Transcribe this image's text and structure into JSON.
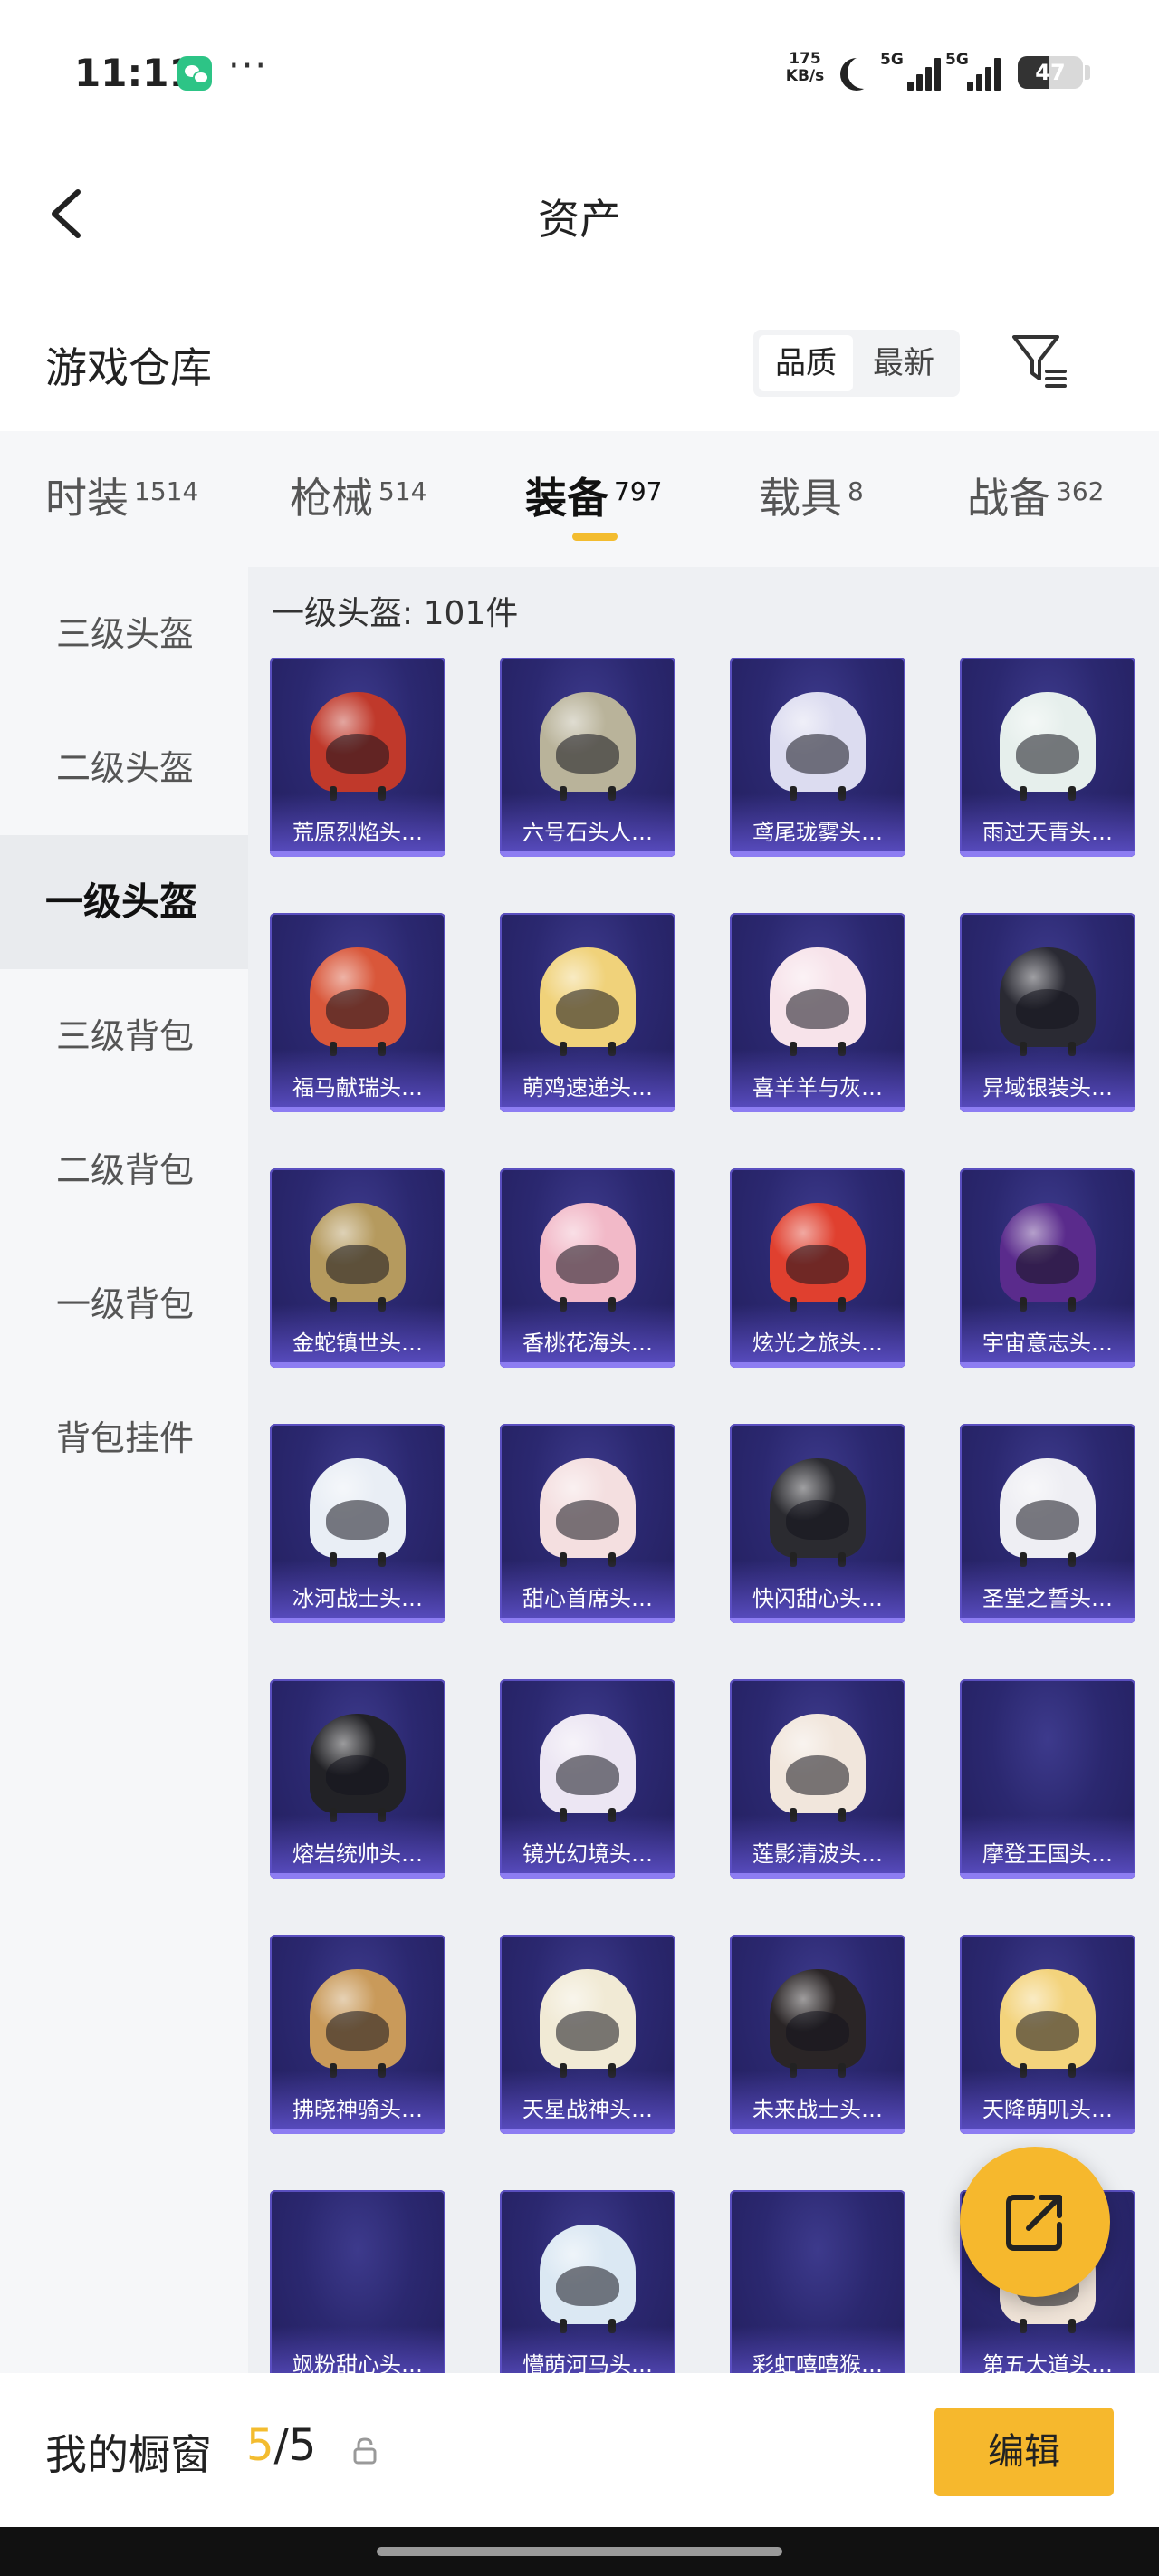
{
  "status_bar": {
    "time": "11:11",
    "net_speed_value": "175",
    "net_speed_unit": "KB/s",
    "signal1_label": "5G",
    "signal2_label": "5G",
    "battery_level": "47"
  },
  "header": {
    "title": "资产"
  },
  "section": {
    "title": "游戏仓库",
    "sort_options": [
      "品质",
      "最新"
    ],
    "active_sort": "品质"
  },
  "categories": [
    {
      "label": "时装",
      "count": "1514"
    },
    {
      "label": "枪械",
      "count": "514"
    },
    {
      "label": "装备",
      "count": "797"
    },
    {
      "label": "载具",
      "count": "8"
    },
    {
      "label": "战备",
      "count": "362"
    }
  ],
  "active_category": "装备",
  "sidebar": {
    "items": [
      "三级头盔",
      "二级头盔",
      "一级头盔",
      "三级背包",
      "二级背包",
      "一级背包",
      "背包挂件"
    ],
    "active": "一级头盔"
  },
  "grid": {
    "title": "一级头盔: 101件",
    "items": [
      {
        "label": "荒原烈焰头…",
        "color": "#c0392b"
      },
      {
        "label": "六号石头人…",
        "color": "#b9b39a"
      },
      {
        "label": "鸢尾珑雾头…",
        "color": "#dcdcf0"
      },
      {
        "label": "雨过天青头…",
        "color": "#e6efec"
      },
      {
        "label": "福马献瑞头…",
        "color": "#d9573a"
      },
      {
        "label": "萌鸡速递头…",
        "color": "#f0d27a"
      },
      {
        "label": "喜羊羊与灰…",
        "color": "#f7e3ea"
      },
      {
        "label": "异域银装头…",
        "color": "#2a2a33"
      },
      {
        "label": "金蛇镇世头…",
        "color": "#b59a5e"
      },
      {
        "label": "香桃花海头…",
        "color": "#f2b9c8"
      },
      {
        "label": "炫光之旅头…",
        "color": "#e0402f"
      },
      {
        "label": "宇宙意志头…",
        "color": "#5a2b8c"
      },
      {
        "label": "冰河战士头…",
        "color": "#e9eef5"
      },
      {
        "label": "甜心首席头…",
        "color": "#f4dfe0"
      },
      {
        "label": "快闪甜心头…",
        "color": "#2b2b30"
      },
      {
        "label": "圣堂之誓头…",
        "color": "#eeeef3"
      },
      {
        "label": "熔岩统帅头…",
        "color": "#222226"
      },
      {
        "label": "镜光幻境头…",
        "color": "#ece6f3"
      },
      {
        "label": "莲影清波头…",
        "color": "#f1e6dc"
      },
      {
        "label": "摩登王国头…",
        "color": ""
      },
      {
        "label": "拂晓神骑头…",
        "color": "#c99a5a"
      },
      {
        "label": "天星战神头…",
        "color": "#f1ead5"
      },
      {
        "label": "未来战士头…",
        "color": "#2a2526"
      },
      {
        "label": "天降萌叽头…",
        "color": "#f3d37c"
      },
      {
        "label": "飒粉甜心头…",
        "color": ""
      },
      {
        "label": "懵萌河马头…",
        "color": "#dbe8f3"
      },
      {
        "label": "彩虹嘻嘻猴…",
        "color": ""
      },
      {
        "label": "第五大道头…",
        "color": "#f0e4d8"
      }
    ]
  },
  "bottom_bar": {
    "showcase_label": "我的橱窗",
    "showcase_current": "5",
    "showcase_separator": "/",
    "showcase_total": "5",
    "edit_label": "编辑"
  },
  "colors": {
    "accent": "#f3bc2f",
    "card_bg": "#2b2870",
    "card_band": "#5b4ec4"
  }
}
